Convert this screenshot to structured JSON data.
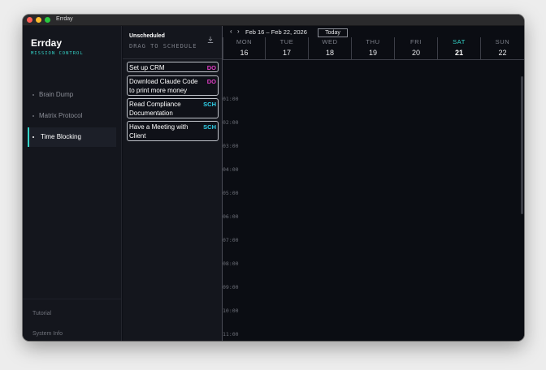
{
  "window": {
    "title": "Errday"
  },
  "sidebar": {
    "brand": "Errday",
    "subtitle": "MISSION CONTROL",
    "items": [
      {
        "label": "Brain Dump",
        "active": false
      },
      {
        "label": "Matrix Protocol",
        "active": false
      },
      {
        "label": "Time Blocking",
        "active": true
      }
    ],
    "footer": [
      "Tutorial",
      "System Info"
    ]
  },
  "unscheduled": {
    "title": "Unscheduled",
    "subtitle": "DRAG TO SCHEDULE",
    "download_icon": "download-icon",
    "tasks": [
      {
        "title": "Set up CRM",
        "badge": "DO",
        "badge_color": "#e23fc6"
      },
      {
        "title": "Download Claude Code to print more money",
        "badge": "DO",
        "badge_color": "#e23fc6"
      },
      {
        "title": "Read Compliance Documentation",
        "badge": "SCH",
        "badge_color": "#2fd0e8"
      },
      {
        "title": "Have a Meeting with Client",
        "badge": "SCH",
        "badge_color": "#2fd0e8"
      }
    ]
  },
  "calendar": {
    "prev_icon": "chevron-left-icon",
    "next_icon": "chevron-right-icon",
    "range": "Feb 16 – Feb 22, 2026",
    "today_label": "Today",
    "days": [
      {
        "name": "MON",
        "date": "16"
      },
      {
        "name": "TUE",
        "date": "17"
      },
      {
        "name": "WED",
        "date": "18"
      },
      {
        "name": "THU",
        "date": "19"
      },
      {
        "name": "FRI",
        "date": "20"
      },
      {
        "name": "SAT",
        "date": "21",
        "today": true
      },
      {
        "name": "SUN",
        "date": "22"
      }
    ],
    "hours": [
      "01:00",
      "02:00",
      "03:00",
      "04:00",
      "05:00",
      "06:00",
      "07:00",
      "08:00",
      "09:00",
      "10:00",
      "11:00"
    ]
  },
  "colors": {
    "accent": "#34d3c8",
    "do_badge": "#e23fc6",
    "schedule_badge": "#2fd0e8",
    "background": "#0d0f16"
  }
}
